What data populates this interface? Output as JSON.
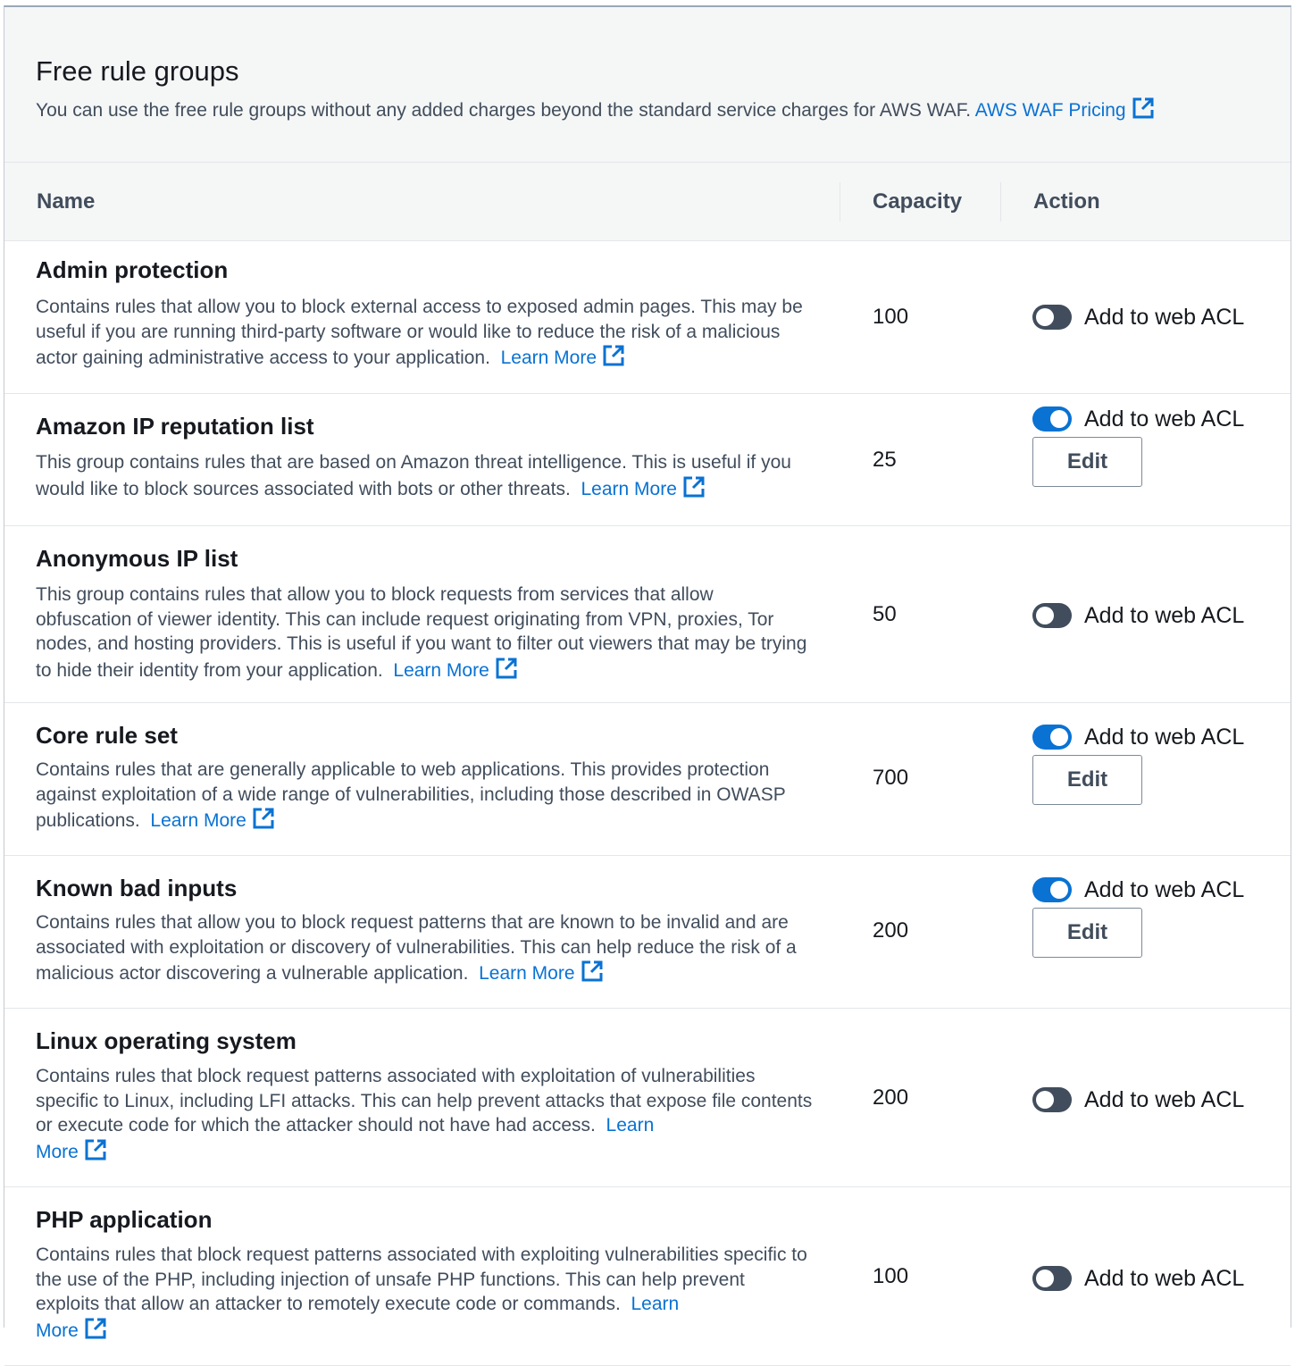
{
  "header": {
    "title": "Free rule groups",
    "subtitle": "You can use the free rule groups without any added charges beyond the standard service charges for AWS WAF.",
    "pricing_link": "AWS WAF Pricing"
  },
  "table": {
    "columns": [
      "Name",
      "Capacity",
      "Action"
    ],
    "toggle_label": "Add to web ACL",
    "edit_label": "Edit",
    "learn_more": "Learn More",
    "learn": "Learn",
    "more": "More",
    "rows": [
      {
        "name": "Admin protection",
        "description": "Contains rules that allow you to block external access to exposed admin pages. This may be useful if you are running third-party software or would like to reduce the risk of a malicious actor gaining administrative access to your application.",
        "capacity": "100",
        "enabled": false
      },
      {
        "name": "Amazon IP reputation list",
        "description": "This group contains rules that are based on Amazon threat intelligence. This is useful if you would like to block sources associated with bots or other threats.",
        "capacity": "25",
        "enabled": true
      },
      {
        "name": "Anonymous IP list",
        "description": "This group contains rules that allow you to block requests from services that allow obfuscation of viewer identity. This can include request originating from VPN, proxies, Tor nodes, and hosting providers. This is useful if you want to filter out viewers that may be trying to hide their identity from your application.",
        "capacity": "50",
        "enabled": false
      },
      {
        "name": "Core rule set",
        "description": "Contains rules that are generally applicable to web applications. This provides protection against exploitation of a wide range of vulnerabilities, including those described in OWASP publications.",
        "capacity": "700",
        "enabled": true
      },
      {
        "name": "Known bad inputs",
        "description": "Contains rules that allow you to block request patterns that are known to be invalid and are associated with exploitation or discovery of vulnerabilities. This can help reduce the risk of a malicious actor discovering a vulnerable application.",
        "capacity": "200",
        "enabled": true
      },
      {
        "name": "Linux operating system",
        "description": "Contains rules that block request patterns associated with exploitation of vulnerabilities specific to Linux, including LFI attacks. This can help prevent attacks that expose file contents or execute code for which the attacker should not have had access.",
        "capacity": "200",
        "enabled": false
      },
      {
        "name": "PHP application",
        "description": "Contains rules that block request patterns associated with exploiting vulnerabilities specific to the use of the PHP, including injection of unsafe PHP functions. This can help prevent exploits that allow an attacker to remotely execute code or commands.",
        "capacity": "100",
        "enabled": false
      }
    ]
  },
  "colors": {
    "link": "#0972d3",
    "toggle_on": "#0972d3",
    "toggle_off": "#414d5c"
  }
}
